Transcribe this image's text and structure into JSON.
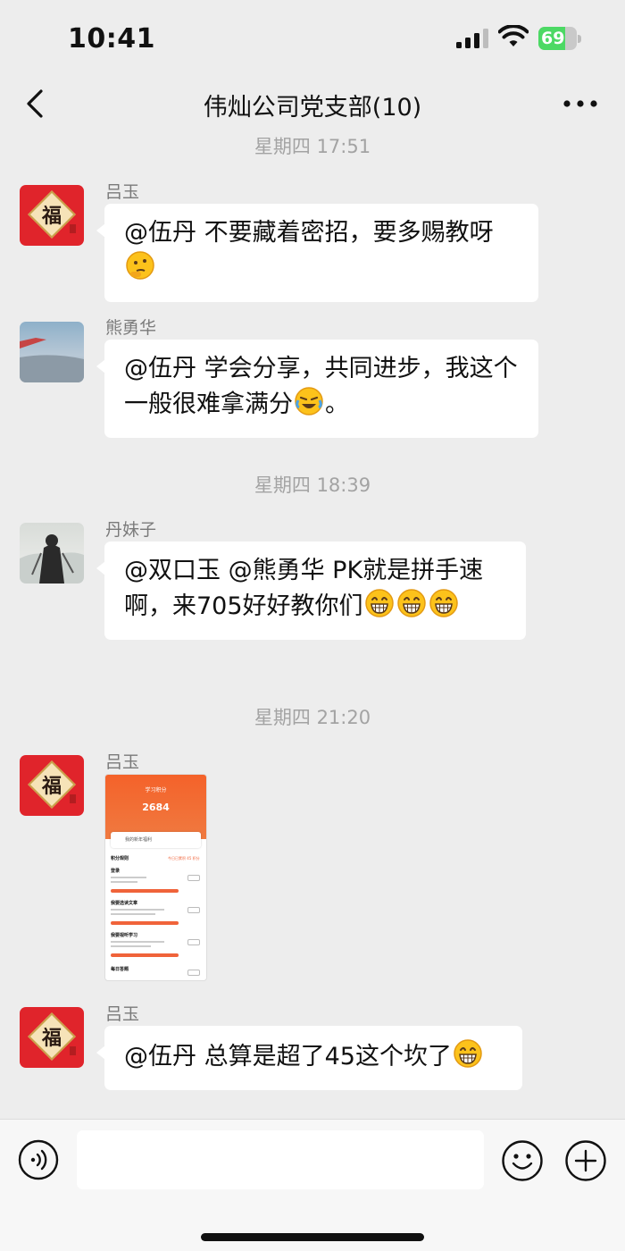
{
  "status_bar": {
    "time": "10:41",
    "battery": "69",
    "battery_level": 0.69
  },
  "header": {
    "title": "伟灿公司党支部(10)"
  },
  "messages": [
    {
      "type": "timestamp",
      "text": "星期四 17:51"
    },
    {
      "type": "message",
      "sender": "吕玉",
      "avatar": "fu-avatar",
      "text": "@伍丹 不要藏着密招，要多赐教呀",
      "emojis": [
        "thinking-emoji"
      ]
    },
    {
      "type": "message",
      "sender": "熊勇华",
      "avatar": "sky-avatar",
      "text": "@伍丹 学会分享，共同进步，我这个一般很难拿满分",
      "emojis": [
        "laugh-cry-emoji"
      ],
      "suffix": "。"
    },
    {
      "type": "timestamp",
      "text": "星期四 18:39"
    },
    {
      "type": "message",
      "sender": "丹妹子",
      "avatar": "portrait-avatar",
      "text": "@双口玉 @熊勇华 PK就是拼手速啊，来705好好教你们",
      "emojis": [
        "grin-emoji",
        "grin-emoji",
        "grin-emoji"
      ]
    },
    {
      "type": "timestamp",
      "text": "星期四 21:20"
    },
    {
      "type": "message",
      "sender": "吕玉",
      "avatar": "fu-avatar",
      "image": {
        "title": "学习积分",
        "score": "2684",
        "card_text": "我的新年福利",
        "section": "积分规则",
        "today": "今日已累积 45 积分",
        "rows": [
          "登录",
          "我要选读文章",
          "我要视听学习",
          "每日答题"
        ],
        "button": "已完成"
      }
    },
    {
      "type": "message",
      "sender": "吕玉",
      "avatar": "fu-avatar",
      "text": "@伍丹 总算是超了45这个坎了",
      "emojis": [
        "grin-emoji"
      ]
    }
  ],
  "input": {
    "placeholder": ""
  },
  "icons": {
    "back": "chevron-left-icon",
    "more": "more-dots-icon",
    "voice": "voice-icon",
    "emoji": "smiley-icon",
    "plus": "plus-icon"
  },
  "colors": {
    "background": "#ededed",
    "bubble": "#ffffff",
    "accent": "#f0633a"
  }
}
